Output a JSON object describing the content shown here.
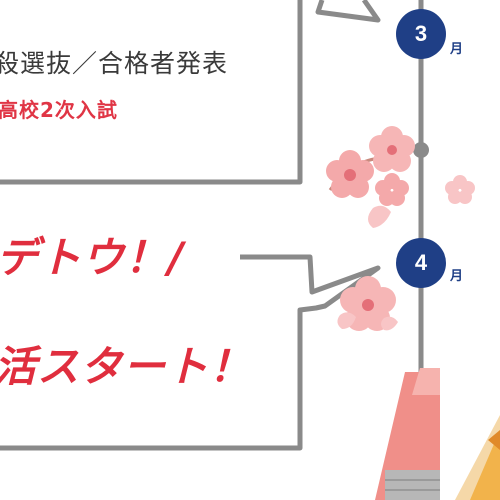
{
  "timeline": {
    "march": {
      "number": "3",
      "unit": "月"
    },
    "april": {
      "number": "4",
      "unit": "月"
    }
  },
  "march_bubble": {
    "line1": "殺選抜／合格者発表",
    "line2": "高校2次入試"
  },
  "april_bubble": {
    "line1": "デトウ！/",
    "line2": "活スタート！"
  },
  "colors": {
    "navy": "#1f3f86",
    "red": "#e02e3e",
    "gray": "#8a8a8a",
    "sakura": "#f4a9aa"
  }
}
